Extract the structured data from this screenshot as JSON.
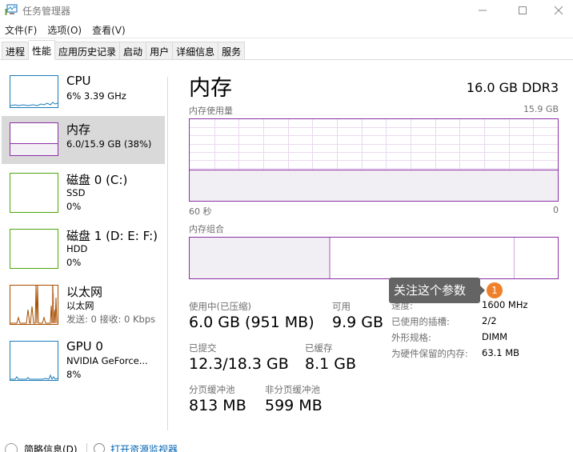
{
  "window": {
    "title": "任务管理器",
    "icon": "task-manager-icon",
    "controls": {
      "minimize": "minimize-icon",
      "maximize": "maximize-icon",
      "close": "close-icon"
    }
  },
  "menu": [
    {
      "label": "文件(F)"
    },
    {
      "label": "选项(O)"
    },
    {
      "label": "查看(V)"
    }
  ],
  "tabs": [
    {
      "label": "进程",
      "active": false
    },
    {
      "label": "性能",
      "active": true
    },
    {
      "label": "应用历史记录",
      "active": false
    },
    {
      "label": "启动",
      "active": false
    },
    {
      "label": "用户",
      "active": false
    },
    {
      "label": "详细信息",
      "active": false
    },
    {
      "label": "服务",
      "active": false
    }
  ],
  "sidebar": {
    "items": [
      {
        "title": "CPU",
        "line1": "6% 3.39 GHz",
        "line2": "",
        "color": "#1a7bb8",
        "selected": false
      },
      {
        "title": "内存",
        "line1": "6.0/15.9 GB (38%)",
        "line2": "",
        "color": "#8b2ea8",
        "selected": true,
        "usage_fraction": 0.38
      },
      {
        "title": "磁盘 0 (C:)",
        "line1": "SSD",
        "line2": "0%",
        "color": "#4da60c",
        "selected": false
      },
      {
        "title": "磁盘 1 (D: E: F:)",
        "line1": "HDD",
        "line2": "0%",
        "color": "#4da60c",
        "selected": false
      },
      {
        "title": "以太网",
        "line1": "以太网",
        "line2": "发送: 0 接收: 0 Kbps",
        "color": "#a74f01",
        "selected": false
      },
      {
        "title": "GPU 0",
        "line1": "NVIDIA GeForce...",
        "line2": "8%",
        "color": "#1a7bb8",
        "selected": false
      }
    ]
  },
  "main": {
    "title": "内存",
    "spec": "16.0 GB DDR3",
    "usage_graph": {
      "label": "内存使用量",
      "max_label": "15.9 GB",
      "x_left_label": "60 秒",
      "x_right_label": "0",
      "usage_fraction": 0.38,
      "color": "#8b2ea8"
    },
    "composition": {
      "label": "内存组合",
      "in_use_fraction": 0.38,
      "standby_fraction": 0.5,
      "free_fraction": 0.12
    },
    "stats": {
      "in_use_label": "使用中(已压缩)",
      "in_use_value": "6.0 GB (951 MB)",
      "available_label": "可用",
      "available_value": "9.9 GB",
      "committed_label": "已提交",
      "committed_value": "12.3/18.3 GB",
      "cached_label": "已缓存",
      "cached_value": "8.1 GB",
      "paged_label": "分页缓冲池",
      "paged_value": "813 MB",
      "nonpaged_label": "非分页缓冲池",
      "nonpaged_value": "599 MB"
    },
    "properties": [
      {
        "label": "速度:",
        "value": "1600 MHz"
      },
      {
        "label": "已使用的插槽:",
        "value": "2/2"
      },
      {
        "label": "外形规格:",
        "value": "DIMM"
      },
      {
        "label": "为硬件保留的内存:",
        "value": "63.1 MB"
      }
    ]
  },
  "annotation": {
    "tooltip": "关注这个参数",
    "badge": "1"
  },
  "bottom": {
    "fewer_details": "简略信息(D)",
    "resource_monitor": "打开资源监视器"
  }
}
